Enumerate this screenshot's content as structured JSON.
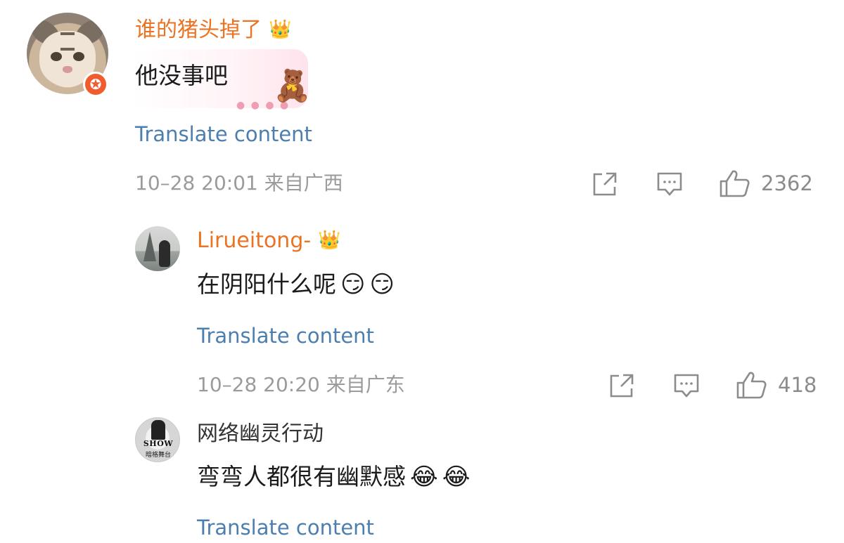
{
  "comments": [
    {
      "username": "谁的猪头掉了",
      "badge_icon": "crown-vip-icon",
      "text": "他没事吧",
      "sticker": "🧸",
      "translate": "Translate content",
      "meta": "10–28 20:01 来自广西",
      "likes": "2362"
    },
    {
      "username": "Lirueitong-",
      "badge_icon": "crown-level-5-icon",
      "text": "在阴阳什么呢",
      "emojis": [
        "😏",
        "😏"
      ],
      "translate": "Translate content",
      "meta": "10–28 20:20 来自广东",
      "likes": "418"
    },
    {
      "username": "网络幽灵行动",
      "text": "弯弯人都很有幽默感",
      "emojis": [
        "😂",
        "😂"
      ],
      "translate": "Translate content"
    }
  ],
  "avatar_text": {
    "show": "SHOW",
    "show_sub": "暗格舞台"
  },
  "colors": {
    "username_orange": "#eb7324",
    "link_blue": "#4c7fb0",
    "meta_gray": "#9b9b9b",
    "badge_red": "#f25b2e"
  }
}
